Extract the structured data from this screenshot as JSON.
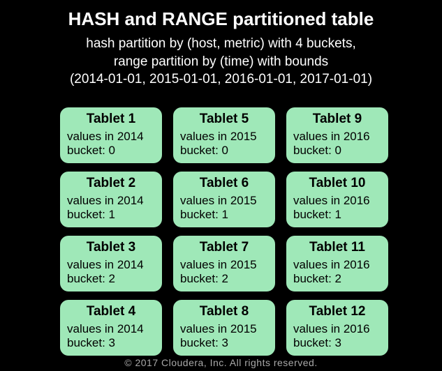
{
  "title": "HASH and RANGE partitioned table",
  "sql_lines": [
    "hash partition by (host, metric) with 4 buckets,",
    "range partition by (time) with bounds",
    "(2014-01-01, 2015-01-01, 2016-01-01, 2017-01-01)"
  ],
  "years": [
    "2014",
    "2015",
    "2016"
  ],
  "buckets": [
    0,
    1,
    2,
    3
  ],
  "tablets": [
    {
      "name": "Tablet 1",
      "year": "2014",
      "bucket": 0
    },
    {
      "name": "Tablet 2",
      "year": "2014",
      "bucket": 1
    },
    {
      "name": "Tablet 3",
      "year": "2014",
      "bucket": 2
    },
    {
      "name": "Tablet 4",
      "year": "2014",
      "bucket": 3
    },
    {
      "name": "Tablet 5",
      "year": "2015",
      "bucket": 0
    },
    {
      "name": "Tablet 6",
      "year": "2015",
      "bucket": 1
    },
    {
      "name": "Tablet 7",
      "year": "2015",
      "bucket": 2
    },
    {
      "name": "Tablet 8",
      "year": "2015",
      "bucket": 3
    },
    {
      "name": "Tablet 9",
      "year": "2016",
      "bucket": 0
    },
    {
      "name": "Tablet 10",
      "year": "2016",
      "bucket": 1
    },
    {
      "name": "Tablet 11",
      "year": "2016",
      "bucket": 2
    },
    {
      "name": "Tablet 12",
      "year": "2016",
      "bucket": 3
    }
  ],
  "values_prefix": "values in ",
  "bucket_prefix": "bucket: ",
  "footer": "© 2017 Cloudera, Inc. All rights reserved."
}
